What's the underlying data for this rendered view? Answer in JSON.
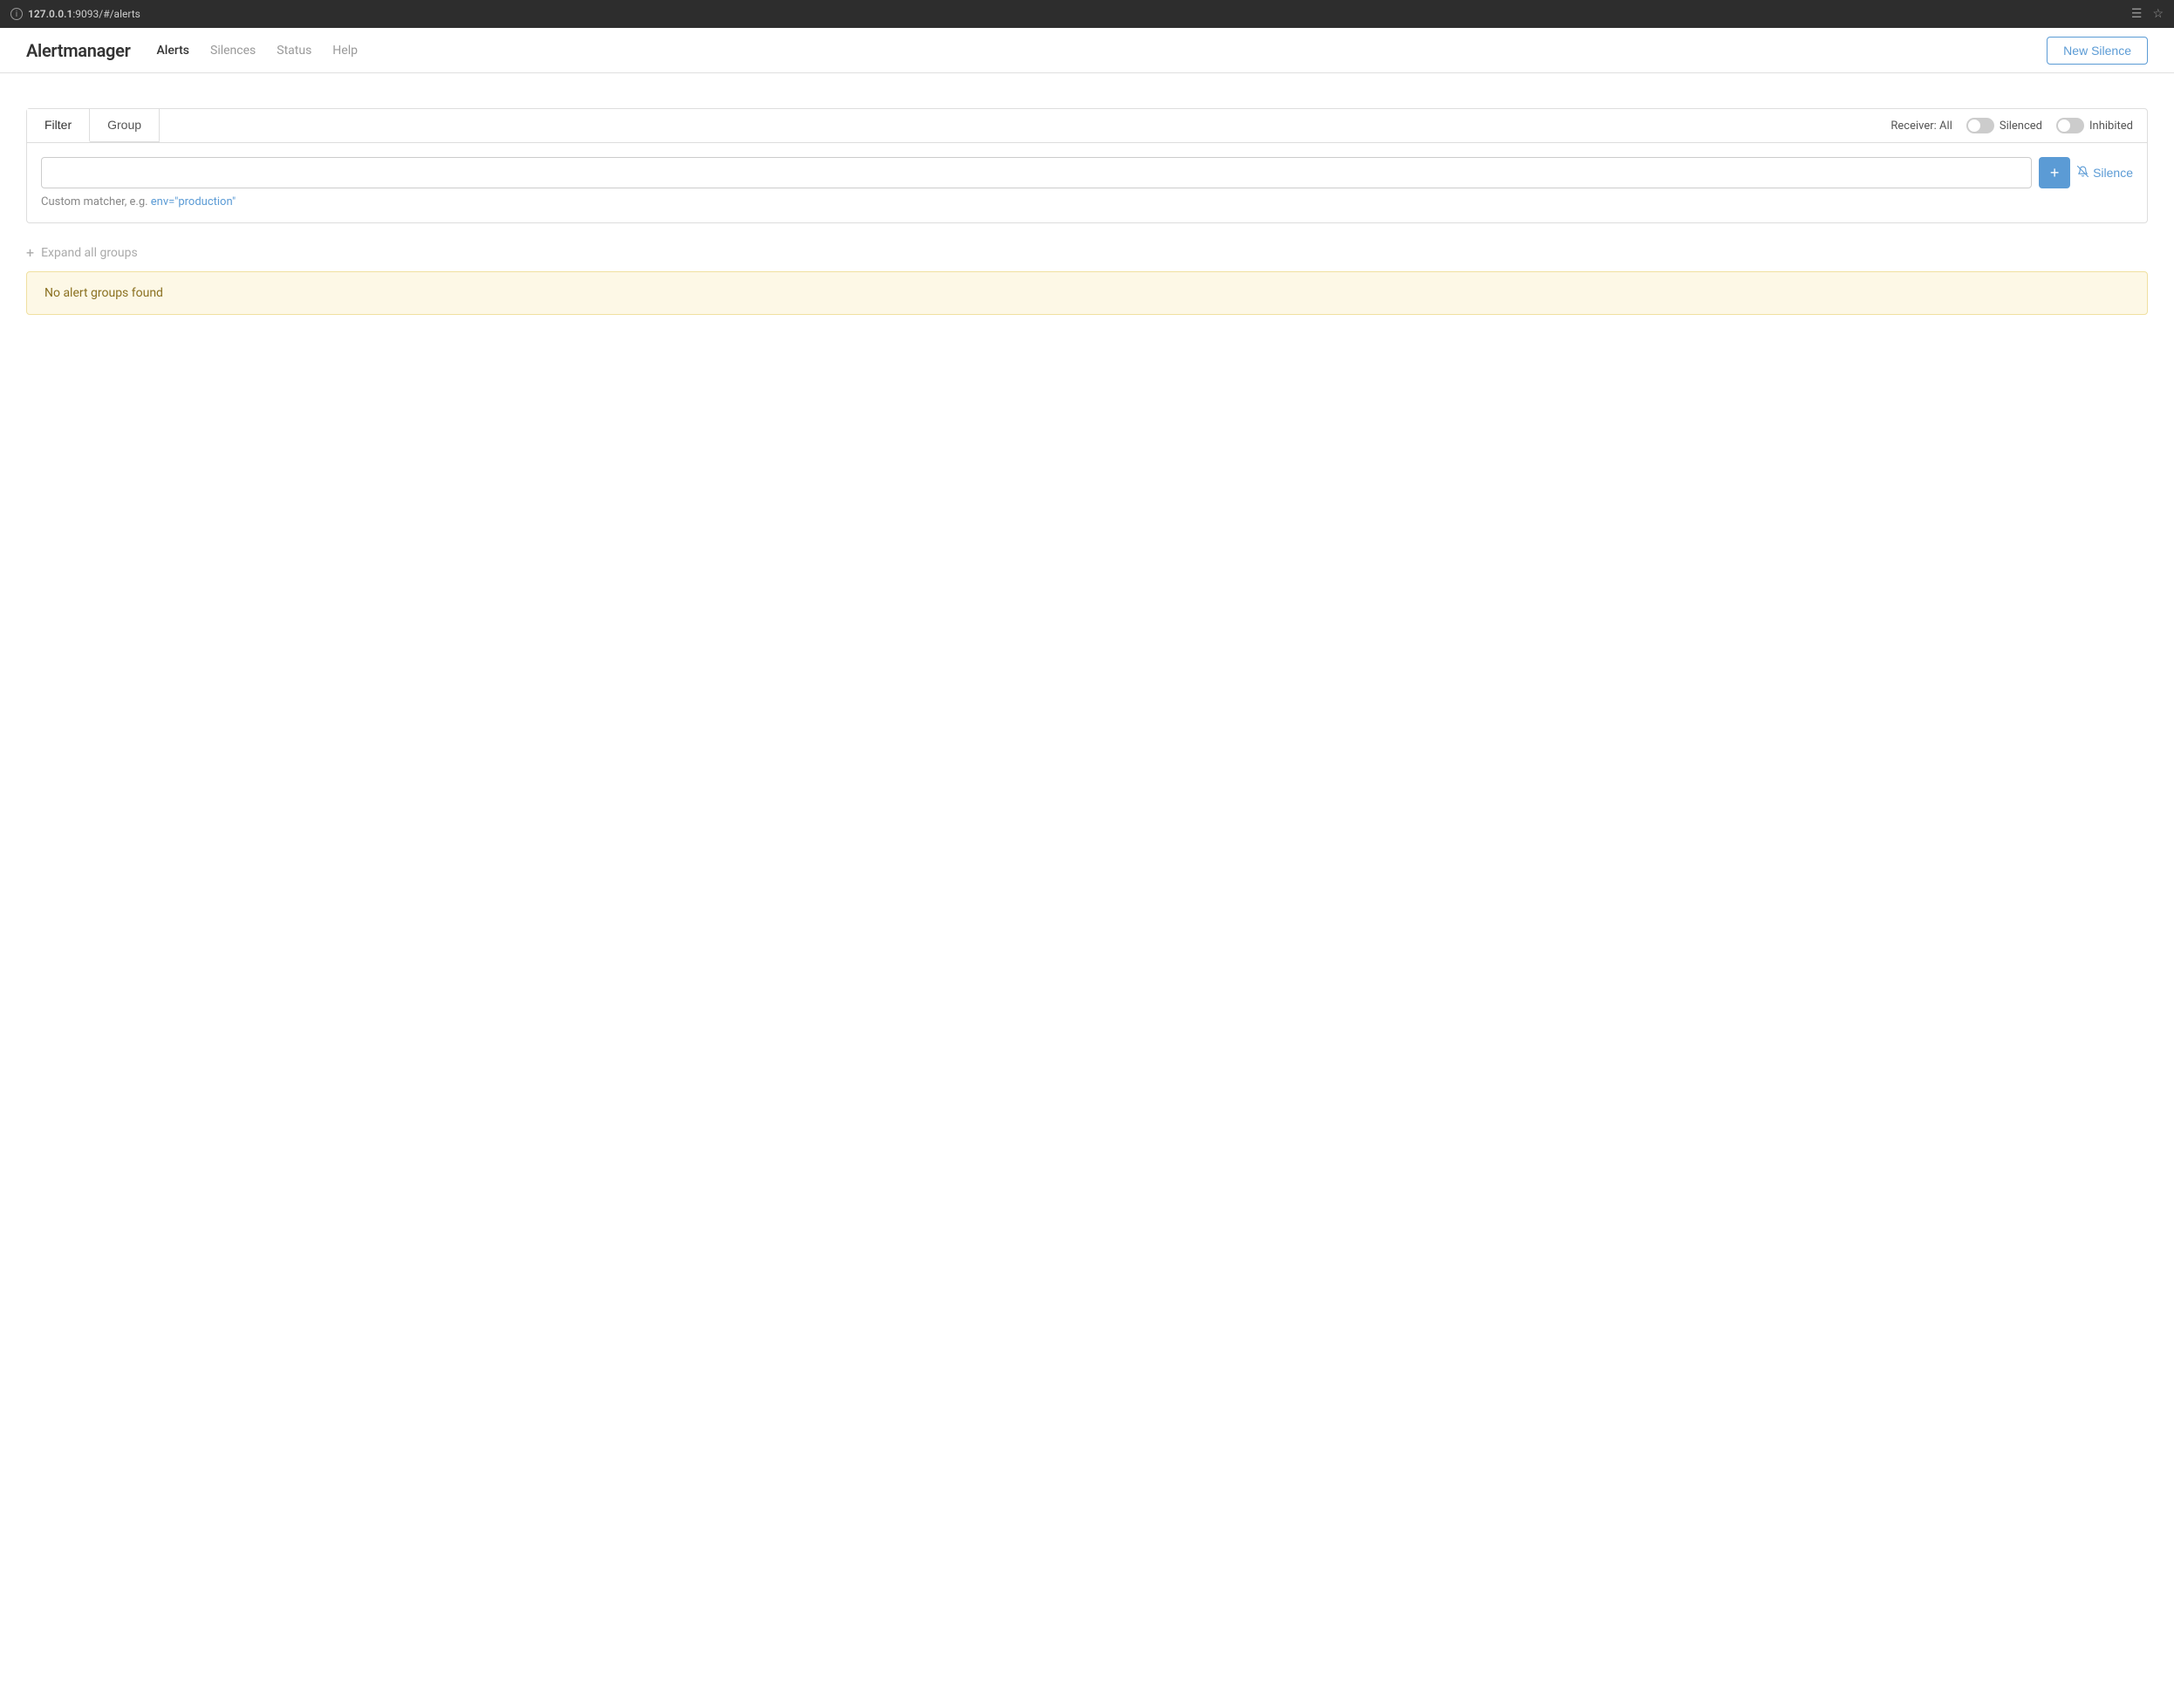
{
  "browser": {
    "url": "127.0.0.1:9093/#/alerts",
    "url_bold_part": "127.0.0.1",
    "url_rest": ":9093/#/alerts"
  },
  "navbar": {
    "brand": "Alertmanager",
    "nav_items": [
      {
        "label": "Alerts",
        "active": true
      },
      {
        "label": "Silences",
        "active": false
      },
      {
        "label": "Status",
        "active": false
      },
      {
        "label": "Help",
        "active": false
      }
    ],
    "new_silence_button": "New Silence"
  },
  "filter": {
    "tab_filter": "Filter",
    "tab_group": "Group",
    "receiver_label": "Receiver: All",
    "silenced_label": "Silenced",
    "inhibited_label": "Inhibited",
    "input_placeholder": "",
    "add_button_label": "+",
    "silence_link_label": "Silence",
    "custom_matcher_hint": "Custom matcher, e.g.",
    "custom_matcher_example": "env=\"production\""
  },
  "groups": {
    "expand_all_label": "Expand all groups",
    "no_alerts_message": "No alert groups found"
  }
}
